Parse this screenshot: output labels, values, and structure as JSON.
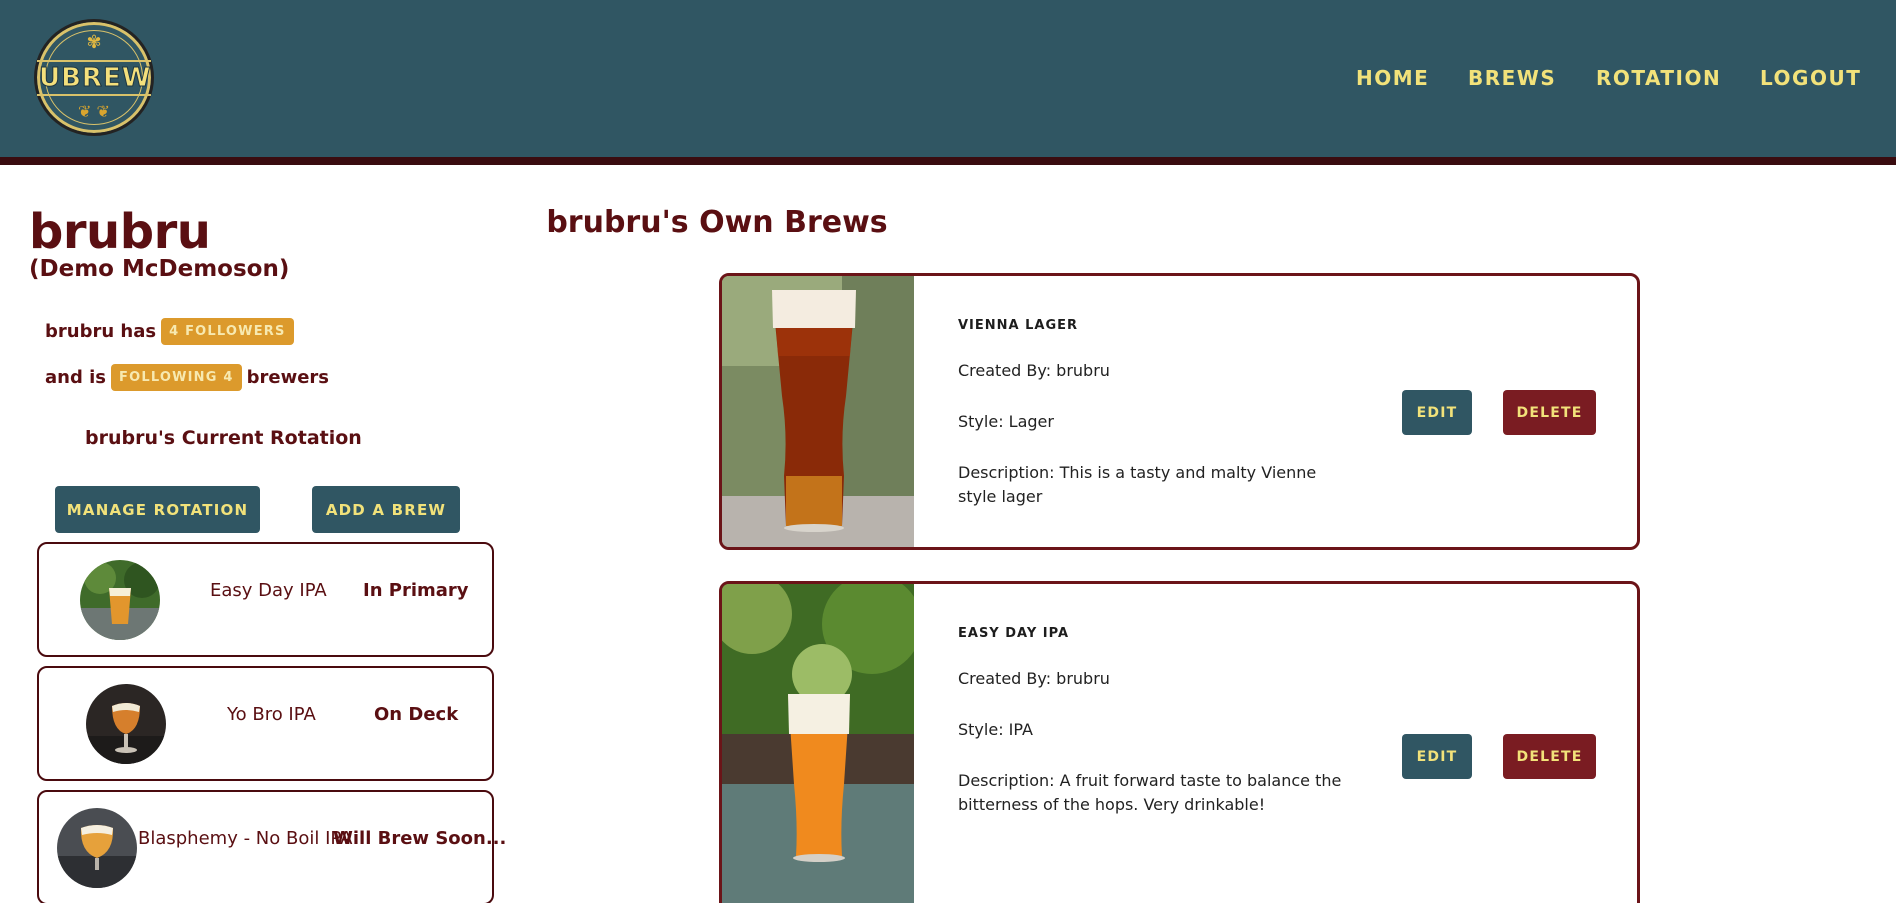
{
  "header": {
    "logo_text": "UBREW",
    "nav": {
      "home": "HOME",
      "brews": "BREWS",
      "rotation": "ROTATION",
      "logout": "LOGOUT"
    }
  },
  "profile": {
    "username": "brubru",
    "full_name": "(Demo McDemoson)",
    "followers_prefix": "brubru has",
    "followers_badge": "4 FOLLOWERS",
    "following_prefix": "and is",
    "following_badge": "FOLLOWING 4",
    "following_suffix": "brewers",
    "rotation_title": "brubru's Current Rotation",
    "manage_rotation_label": "MANAGE ROTATION",
    "add_brew_label": "ADD A BREW"
  },
  "rotation": [
    {
      "name": "Easy Day IPA",
      "status": "In Primary"
    },
    {
      "name": "Yo Bro IPA",
      "status": "On Deck"
    },
    {
      "name": "Blasphemy - No Boil IPA",
      "status": "Will Brew Soon..."
    }
  ],
  "brews_section": {
    "title": "brubru's Own Brews",
    "edit_label": "EDIT",
    "delete_label": "DELETE",
    "items": [
      {
        "name": "VIENNA LAGER",
        "created_by": "Created By: brubru",
        "style": "Style: Lager",
        "description": "Description: This is a tasty and malty Vienne style lager"
      },
      {
        "name": "EASY DAY IPA",
        "created_by": "Created By: brubru",
        "style": "Style: IPA",
        "description": "Description: A fruit forward taste to balance the bitterness of the hops. Very drinkable!"
      }
    ]
  },
  "colors": {
    "header": "#305663",
    "accent_yellow": "#f2e27a",
    "maroon": "#5a0f12",
    "badge": "#dc9a2c",
    "delete": "#7a1c22"
  }
}
